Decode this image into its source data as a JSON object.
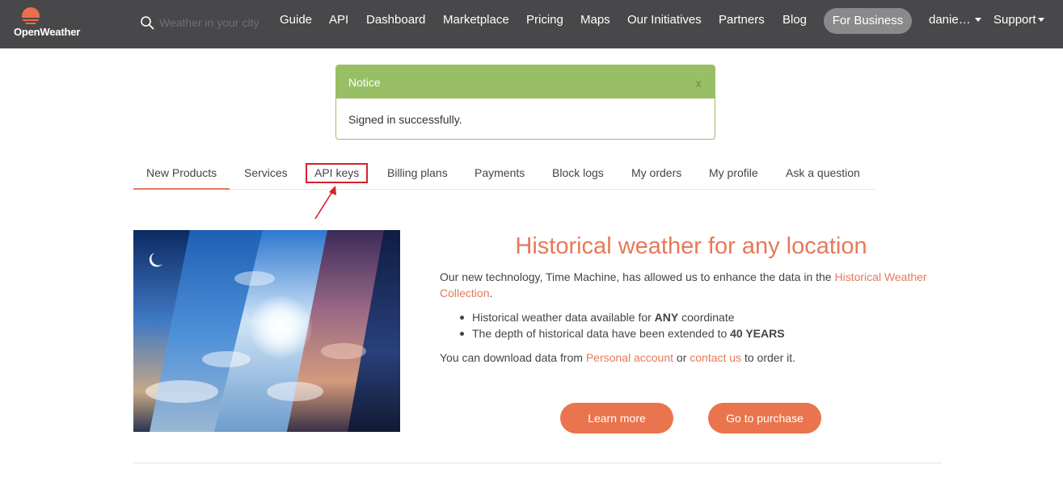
{
  "nav": {
    "logo_text": "OpenWeather",
    "search_placeholder": "Weather in your city",
    "links": [
      "Guide",
      "API",
      "Dashboard",
      "Marketplace",
      "Pricing",
      "Maps",
      "Our Initiatives",
      "Partners",
      "Blog"
    ],
    "business_label": "For Business",
    "user_label": "danie…",
    "support_label": "Support"
  },
  "notice": {
    "title": "Notice",
    "close_label": "x",
    "message": "Signed in successfully."
  },
  "tabs": [
    "New Products",
    "Services",
    "API keys",
    "Billing plans",
    "Payments",
    "Block logs",
    "My orders",
    "My profile",
    "Ask a question"
  ],
  "hero": {
    "title": "Historical weather for any location",
    "intro_before": "Our new technology, Time Machine, has allowed us to enhance the data in the ",
    "intro_link": "Historical Weather Collection",
    "intro_after": ".",
    "bullet1_text": "Historical weather data available for ",
    "bullet1_bold": "ANY",
    "bullet1_after": " coordinate",
    "bullet2_text": "The depth of historical data have been extended to ",
    "bullet2_bold": "40 YEARS",
    "download_before": "You can download data from ",
    "download_link1": "Personal account",
    "download_mid": " or ",
    "download_link2": "contact us",
    "download_after": " to order it.",
    "learn_more": "Learn more",
    "purchase": "Go to purchase"
  },
  "colors": {
    "accent": "#e6795a",
    "nav_bg": "#48484a",
    "notice_green": "#98bf66",
    "highlight_red": "#d6212d"
  },
  "icons": {
    "logo": "openweather-sun-icon",
    "search": "search-icon",
    "caret": "caret-down-icon",
    "arrow": "red-arrow-icon"
  }
}
